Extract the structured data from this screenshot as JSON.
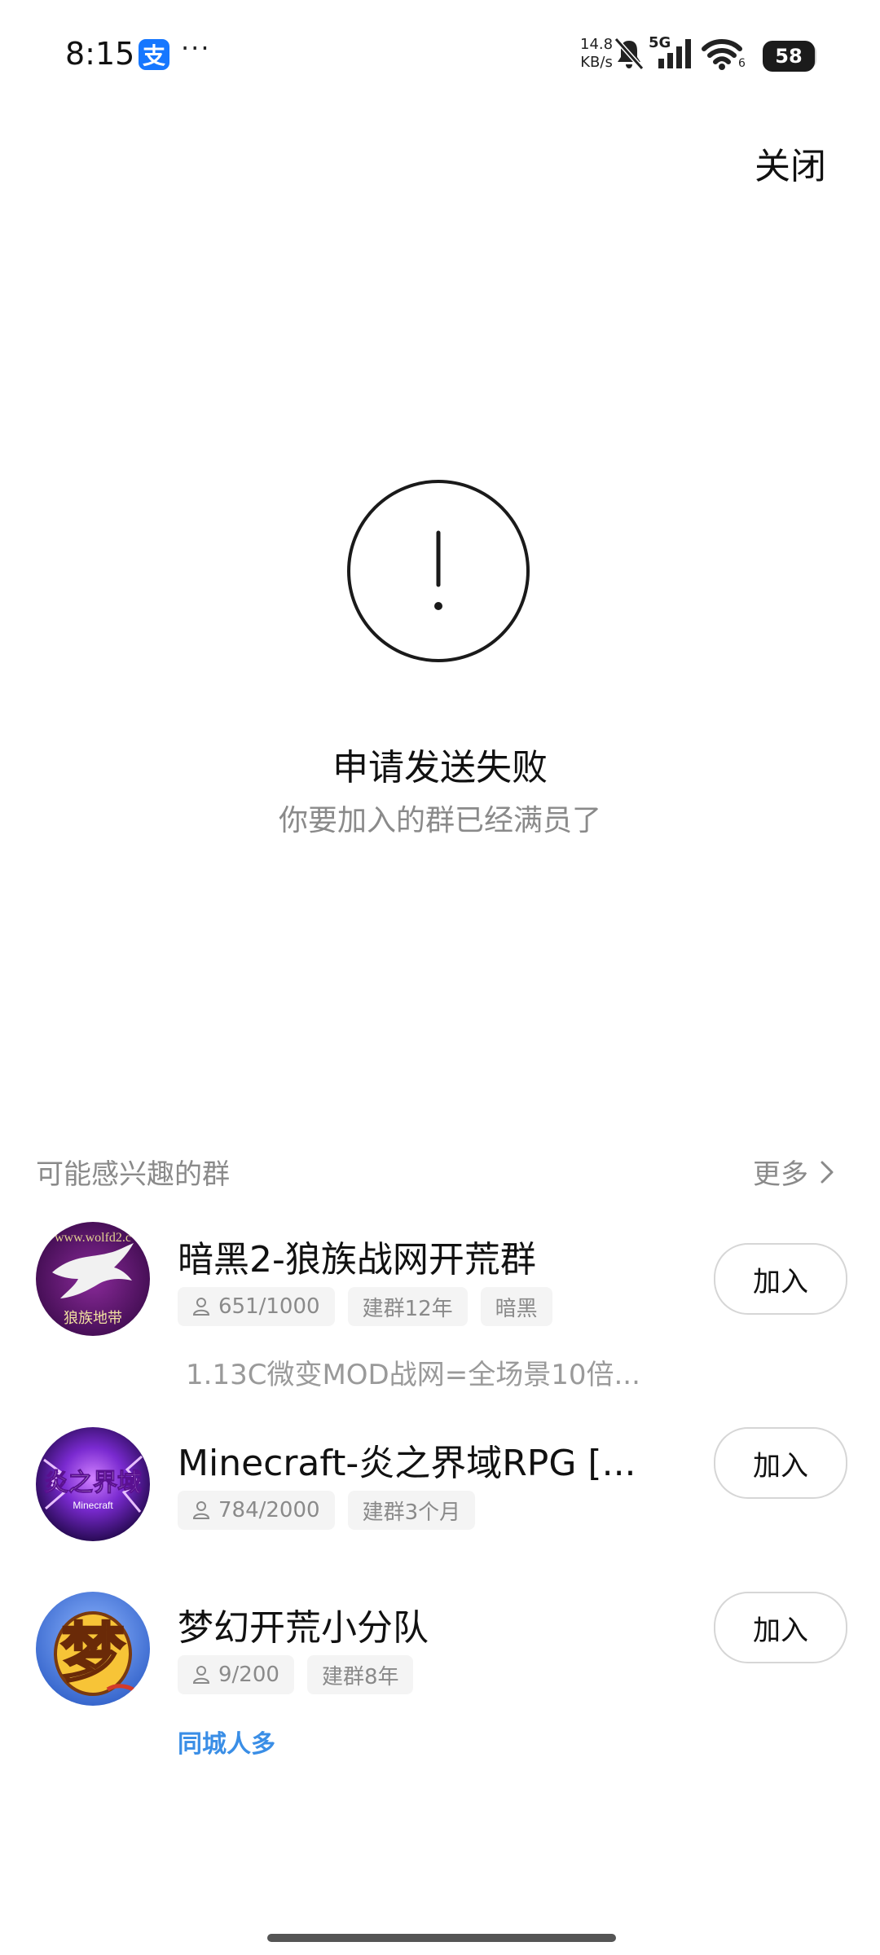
{
  "status": {
    "time": "8:15",
    "alipay_icon_text": "支",
    "dots": "···",
    "speed_value": "14.8",
    "speed_unit": "KB/s",
    "network": "5G",
    "wifi_level": "6",
    "battery": "58"
  },
  "close_label": "关闭",
  "alert": {
    "icon": "exclamation-circle-icon",
    "title": "申请发送失败",
    "description": "你要加入的群已经满员了"
  },
  "recommend": {
    "title": "可能感兴趣的群",
    "more": "更多",
    "groups": [
      {
        "name": "暗黑2-狼族战网开荒群",
        "members": "651/1000",
        "tag1": "建群12年",
        "tag2": "暗黑",
        "desc": "1.13C微变MOD战网=全场景10倍...",
        "join": "加入",
        "avatar_text_top": "www.wolfd2.c",
        "avatar_text_bottom": "狼族地带"
      },
      {
        "name": "Minecraft-炎之界域RPG [...",
        "members": "784/2000",
        "tag1": "建群3个月",
        "join": "加入",
        "avatar_text_top": "炎之界域",
        "avatar_text_bottom": "Minecraft"
      },
      {
        "name": "梦幻开荒小分队",
        "members": "9/200",
        "tag1": "建群8年",
        "hot": "同城人多",
        "join": "加入",
        "avatar_text_top": "梦"
      }
    ]
  },
  "colors": {
    "accent_blue": "#3a8ee6",
    "alipay_blue": "#1677ff",
    "muted_text": "#8a8a8a"
  }
}
